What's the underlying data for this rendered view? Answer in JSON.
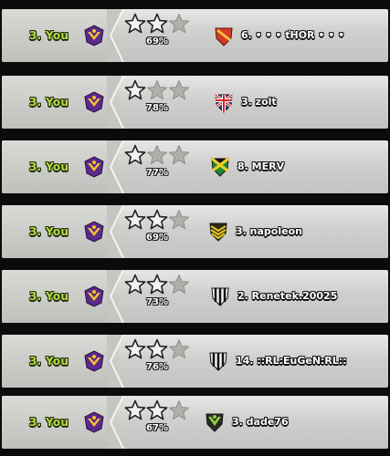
{
  "colors": {
    "you_green": "#b5d94a",
    "star_filled": "#f2f2f2",
    "star_empty": "#aeb0ac",
    "dots_gold": "#e8d36a"
  },
  "attacks": [
    {
      "you_label": "3. You",
      "stars": 2,
      "max_stars": 3,
      "percent": "69%",
      "opponent": "6. • • • ťHOR • • •",
      "opponent_badge": "red-shield-icon"
    },
    {
      "you_label": "3. You",
      "stars": 1,
      "max_stars": 3,
      "percent": "78%",
      "opponent": "3. zolt",
      "opponent_badge": "union-jack-shield-icon"
    },
    {
      "you_label": "3. You",
      "stars": 1,
      "max_stars": 3,
      "percent": "77%",
      "opponent": "8. MERV",
      "opponent_badge": "jamaica-shield-icon"
    },
    {
      "you_label": "3. You",
      "stars": 2,
      "max_stars": 3,
      "percent": "69%",
      "opponent": "3. napoleon",
      "opponent_badge": "chevron-shield-icon"
    },
    {
      "you_label": "3. You",
      "stars": 2,
      "max_stars": 3,
      "percent": "73%",
      "opponent": "2. Renetek.20025",
      "opponent_badge": "striped-shield-icon"
    },
    {
      "you_label": "3. You",
      "stars": 2,
      "max_stars": 3,
      "percent": "76%",
      "opponent": "14. ::RL:EuGeN:RL::",
      "opponent_badge": "striped-shield-icon"
    },
    {
      "you_label": "3. You",
      "stars": 2,
      "max_stars": 3,
      "percent": "67%",
      "opponent": "3. dade76",
      "opponent_badge": "green-eagle-shield-icon"
    }
  ]
}
